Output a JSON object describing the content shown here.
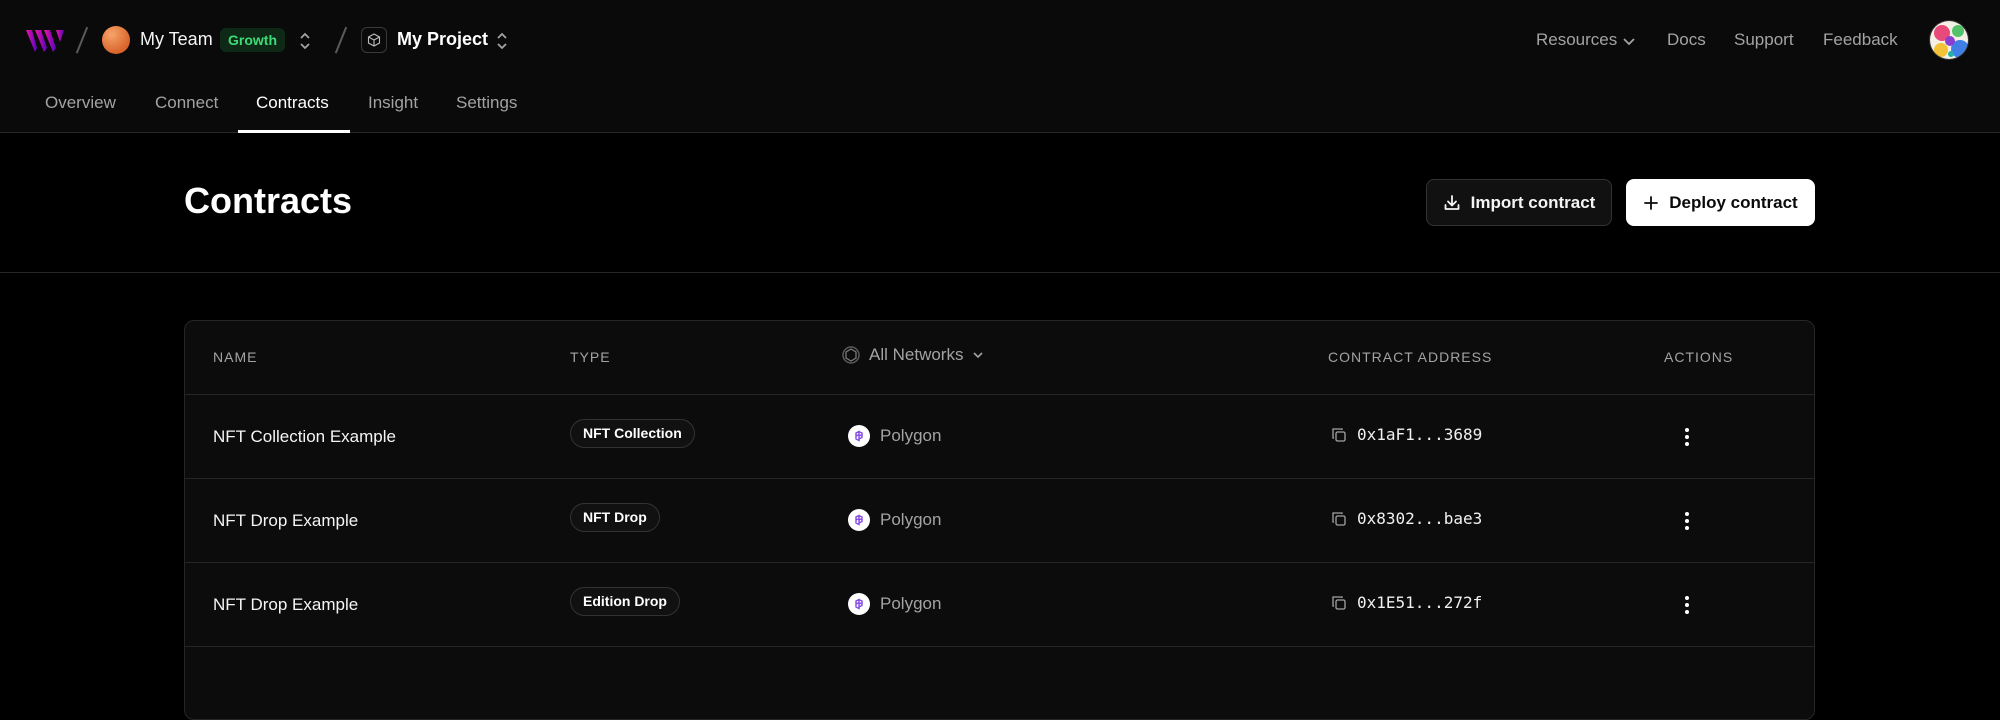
{
  "header": {
    "team_name": "My Team",
    "plan_badge": "Growth",
    "project_name": "My Project",
    "nav_links": {
      "resources": "Resources",
      "docs": "Docs",
      "support": "Support",
      "feedback": "Feedback"
    }
  },
  "tabs": [
    {
      "label": "Overview",
      "active": false
    },
    {
      "label": "Connect",
      "active": false
    },
    {
      "label": "Contracts",
      "active": true
    },
    {
      "label": "Insight",
      "active": false
    },
    {
      "label": "Settings",
      "active": false
    }
  ],
  "page": {
    "title": "Contracts",
    "import_label": "Import contract",
    "deploy_label": "Deploy contract"
  },
  "table": {
    "headers": {
      "name": "NAME",
      "type": "TYPE",
      "network_filter": "All Networks",
      "address": "CONTRACT ADDRESS",
      "actions": "ACTIONS"
    },
    "rows": [
      {
        "name": "NFT Collection Example",
        "type": "NFT Collection",
        "network": "Polygon",
        "address": "0x1aF1...3689"
      },
      {
        "name": "NFT Drop Example",
        "type": "NFT Drop",
        "network": "Polygon",
        "address": "0x8302...bae3"
      },
      {
        "name": "NFT Drop Example",
        "type": "Edition Drop",
        "network": "Polygon",
        "address": "0x1E51...272f"
      }
    ]
  },
  "colors": {
    "background": "#000000",
    "header_bg": "#0a0a0a",
    "badge_green": "#3ddc77",
    "polygon_purple": "#8247e5",
    "logo_gradient_start": "#f213a4",
    "logo_gradient_end": "#5204bf"
  }
}
